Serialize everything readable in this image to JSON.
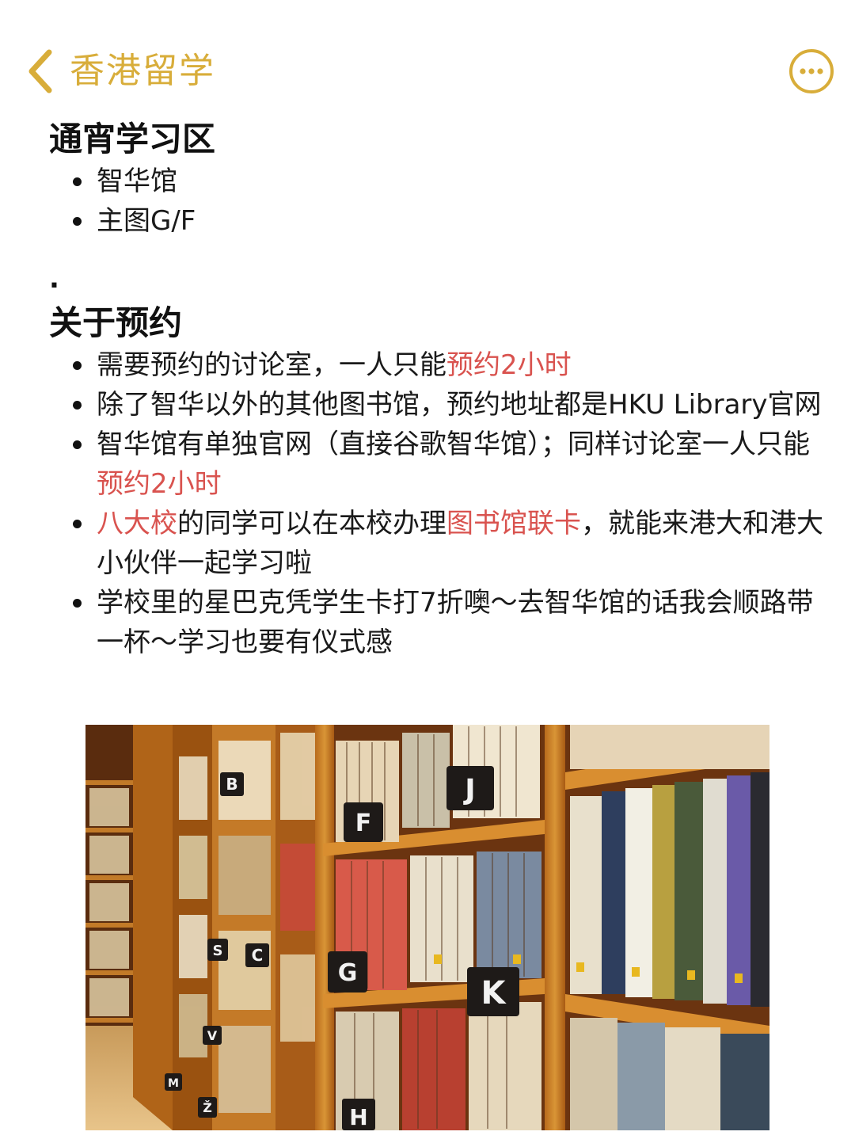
{
  "nav": {
    "back_icon": "chevron-left-icon",
    "title": "香港留学",
    "more_icon": "more-horizontal-icon",
    "accent_color": "#d8ad3a"
  },
  "section1": {
    "heading": "通宵学习区",
    "items": [
      "智华馆",
      "主图G/F"
    ]
  },
  "separator": ".",
  "section2": {
    "heading": "关于预约",
    "items": [
      {
        "parts": [
          {
            "t": "需要预约的讨论室，一人只能",
            "hl": false
          },
          {
            "t": "预约2小时",
            "hl": true
          }
        ]
      },
      {
        "parts": [
          {
            "t": "除了智华以外的其他图书馆，预约地址都是HKU Library官网",
            "hl": false
          }
        ]
      },
      {
        "parts": [
          {
            "t": "智华馆有单独官网（直接谷歌智华馆）；同样讨论室一人只能",
            "hl": false
          },
          {
            "t": "预约2小时",
            "hl": true
          }
        ]
      },
      {
        "parts": [
          {
            "t": "八大校",
            "hl": true
          },
          {
            "t": "的同学可以在本校办理",
            "hl": false
          },
          {
            "t": "图书馆联卡",
            "hl": true
          },
          {
            "t": "，就能来港大和港大小伙伴一起学习啦",
            "hl": false
          }
        ]
      },
      {
        "parts": [
          {
            "t": "学校里的星巴克凭学生卡打7折噢～去智华馆的话我会顺路带一杯～学习也要有仪式感",
            "hl": false
          }
        ]
      }
    ],
    "highlight_color": "#d9534f"
  },
  "photo": {
    "shelf_labels": [
      "J",
      "F",
      "G",
      "K",
      "H",
      "B",
      "C",
      "S",
      "V",
      "Ž",
      "M"
    ]
  }
}
